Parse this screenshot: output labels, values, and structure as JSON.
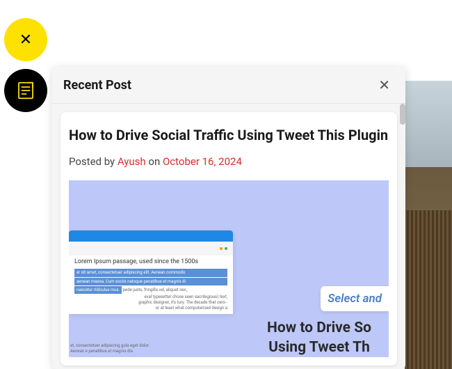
{
  "fab": {
    "close_symbol": "✕"
  },
  "panel": {
    "title": "Recent Post",
    "close_symbol": "✕"
  },
  "post": {
    "title": "How to Drive Social Traffic Using Tweet This Plugin",
    "meta_prefix": "Posted by ",
    "author": "Ayush",
    "meta_middle": " on ",
    "date": "October 16, 2024"
  },
  "mockup": {
    "content_title": "Lorem Ipsum passage, used since the 1500s",
    "line1": "er sit amet, consectetuer adipiscing elit. Aenean commodo",
    "line2": "aenean massa. Cum sociis natoque penatibus et magnis di",
    "line3a": "nascetur ridiculus mus.",
    "line3b": " pede justo, fringilla vel, aliquet nec,",
    "tail_text": "eval typesetter chose seen sacrilegious) text, graphic designer, it's tury. The decade that cero--or at least what computerized design a",
    "bottom_text": "et, consectetuer adipiscing gula eget dolor. Aenean e penatibus et magnis dis",
    "select_label": "Select and",
    "big_title_line1": "How to Drive So",
    "big_title_line2": "Using Tweet Th"
  }
}
